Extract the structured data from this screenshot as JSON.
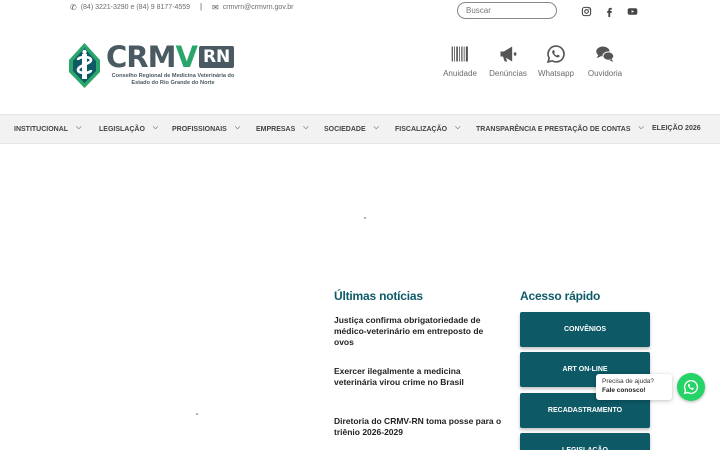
{
  "topbar": {
    "phone": "(84) 3221-3290 e (84) 9 8177-4559",
    "separator": "|",
    "email": "crmvrn@crmvrn.gov.br",
    "search_placeholder": "Buscar"
  },
  "social": [
    {
      "icon": "instagram-icon"
    },
    {
      "icon": "facebook-icon"
    },
    {
      "icon": "youtube-icon"
    }
  ],
  "logo": {
    "word_crm": "CRM",
    "word_v": "V",
    "word_rn": "RN",
    "subtitle": "Conselho Regional de Medicina Veterinária do Estado do Rio Grande do Norte"
  },
  "quick_icons": [
    {
      "label": "Anuidade",
      "icon": "barcode-icon"
    },
    {
      "label": "Denúncias",
      "icon": "megaphone-icon"
    },
    {
      "label": "Whatsapp",
      "icon": "whatsapp-icon"
    },
    {
      "label": "Ouvidoria",
      "icon": "chat-bubbles-icon"
    }
  ],
  "nav": [
    {
      "label": "INSTITUCIONAL",
      "dropdown": true
    },
    {
      "label": "LEGISLAÇÃO",
      "dropdown": true
    },
    {
      "label": "PROFISSIONAIS",
      "dropdown": true
    },
    {
      "label": "EMPRESAS",
      "dropdown": true
    },
    {
      "label": "SOCIEDADE",
      "dropdown": true
    },
    {
      "label": "FISCALIZAÇÃO",
      "dropdown": true
    },
    {
      "label": "TRANSPARÊNCIA E PRESTAÇÃO DE CONTAS",
      "dropdown": true
    },
    {
      "label": "ELEIÇÃO 2026",
      "dropdown": false
    }
  ],
  "chevron": "⌵",
  "news": {
    "heading": "Últimas notícias",
    "items": [
      "Justiça confirma obrigatoriedade de médico-veterinário em entreposto de ovos",
      "Exercer ilegalmente a medicina veterinária virou crime no Brasil",
      "Diretoria do CRMV-RN toma posse para o triênio 2026-2029"
    ]
  },
  "quick_access": {
    "heading": "Acesso rápido",
    "buttons": [
      "CONVÊNIOS",
      "ART ON-LINE",
      "RECADASTRAMENTO",
      "LEGISLAÇÃO"
    ]
  },
  "whatsapp_widget": {
    "text": "Precisa de ajuda?",
    "bold": "Fale conosco!"
  },
  "colors": {
    "brand_teal": "#0d5966",
    "brand_green": "#2aa66a",
    "logo_gray": "#4a5a63",
    "whatsapp_green": "#25d366"
  }
}
